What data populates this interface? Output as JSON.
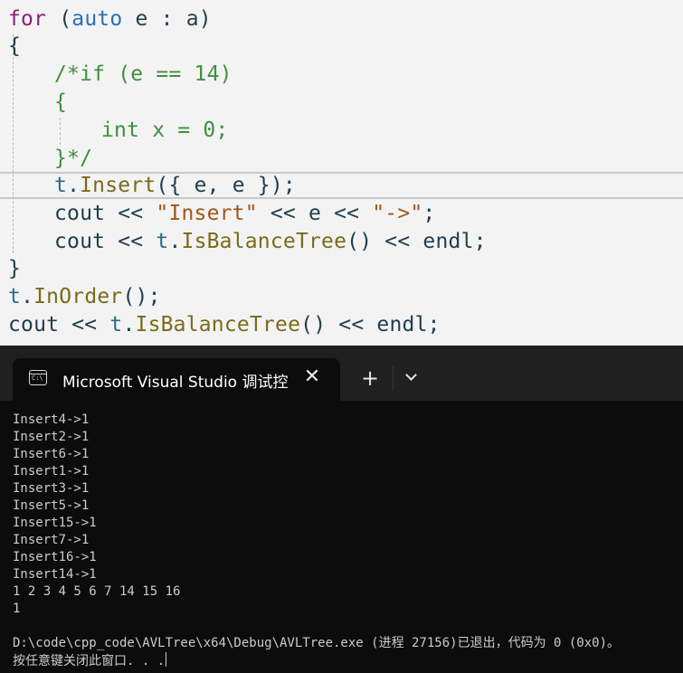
{
  "editor": {
    "top_partial": "t.Insert(...); ...",
    "lines": {
      "l1_for": "for",
      "l1_paren_open": " (",
      "l1_auto": "auto",
      "l1_rest": " e : a)",
      "l2": "{",
      "l3": "/*if (e == 14)",
      "l4": "{",
      "l5": "int x = 0;",
      "l6": "}*/",
      "l7_obj": "t",
      "l7_dot": ".",
      "l7_fn": "Insert",
      "l7_rest": "({ e, e });",
      "l8_a": "cout << ",
      "l8_str1": "\"Insert\"",
      "l8_b": " << e << ",
      "l8_str2": "\"->\"",
      "l8_c": ";",
      "l9_a": "cout << ",
      "l9_obj": "t",
      "l9_dot": ".",
      "l9_fn": "IsBalanceTree",
      "l9_rest": "() << endl;",
      "l10": "}",
      "l11_obj": "t",
      "l11_dot": ".",
      "l11_fn": "InOrder",
      "l11_rest": "();",
      "l12_a": "cout << ",
      "l12_obj": "t",
      "l12_dot": ".",
      "l12_fn": "IsBalanceTree",
      "l12_rest": "() << endl;"
    }
  },
  "terminal": {
    "tab_icon_text": "C:\\",
    "tab_title": "Microsoft Visual Studio 调试控",
    "close_glyph": "✕",
    "new_tab_glyph": "+",
    "output": [
      "Insert4->1",
      "Insert2->1",
      "Insert6->1",
      "Insert1->1",
      "Insert3->1",
      "Insert5->1",
      "Insert15->1",
      "Insert7->1",
      "Insert16->1",
      "Insert14->1",
      "1 2 3 4 5 6 7 14 15 16",
      "1",
      "",
      "D:\\code\\cpp_code\\AVLTree\\x64\\Debug\\AVLTree.exe (进程 27156)已退出，代码为 0 (0x0)。",
      "按任意键关闭此窗口. . ."
    ]
  },
  "colors": {
    "editor_bg": "#f3f3f3",
    "keyword": "#8a1e7a",
    "type": "#2b70b8",
    "comment": "#3f8f3f",
    "string": "#a0561a",
    "terminal_bg": "#0c0c0c",
    "tabbar_bg": "#202020",
    "terminal_text": "#cccccc"
  }
}
